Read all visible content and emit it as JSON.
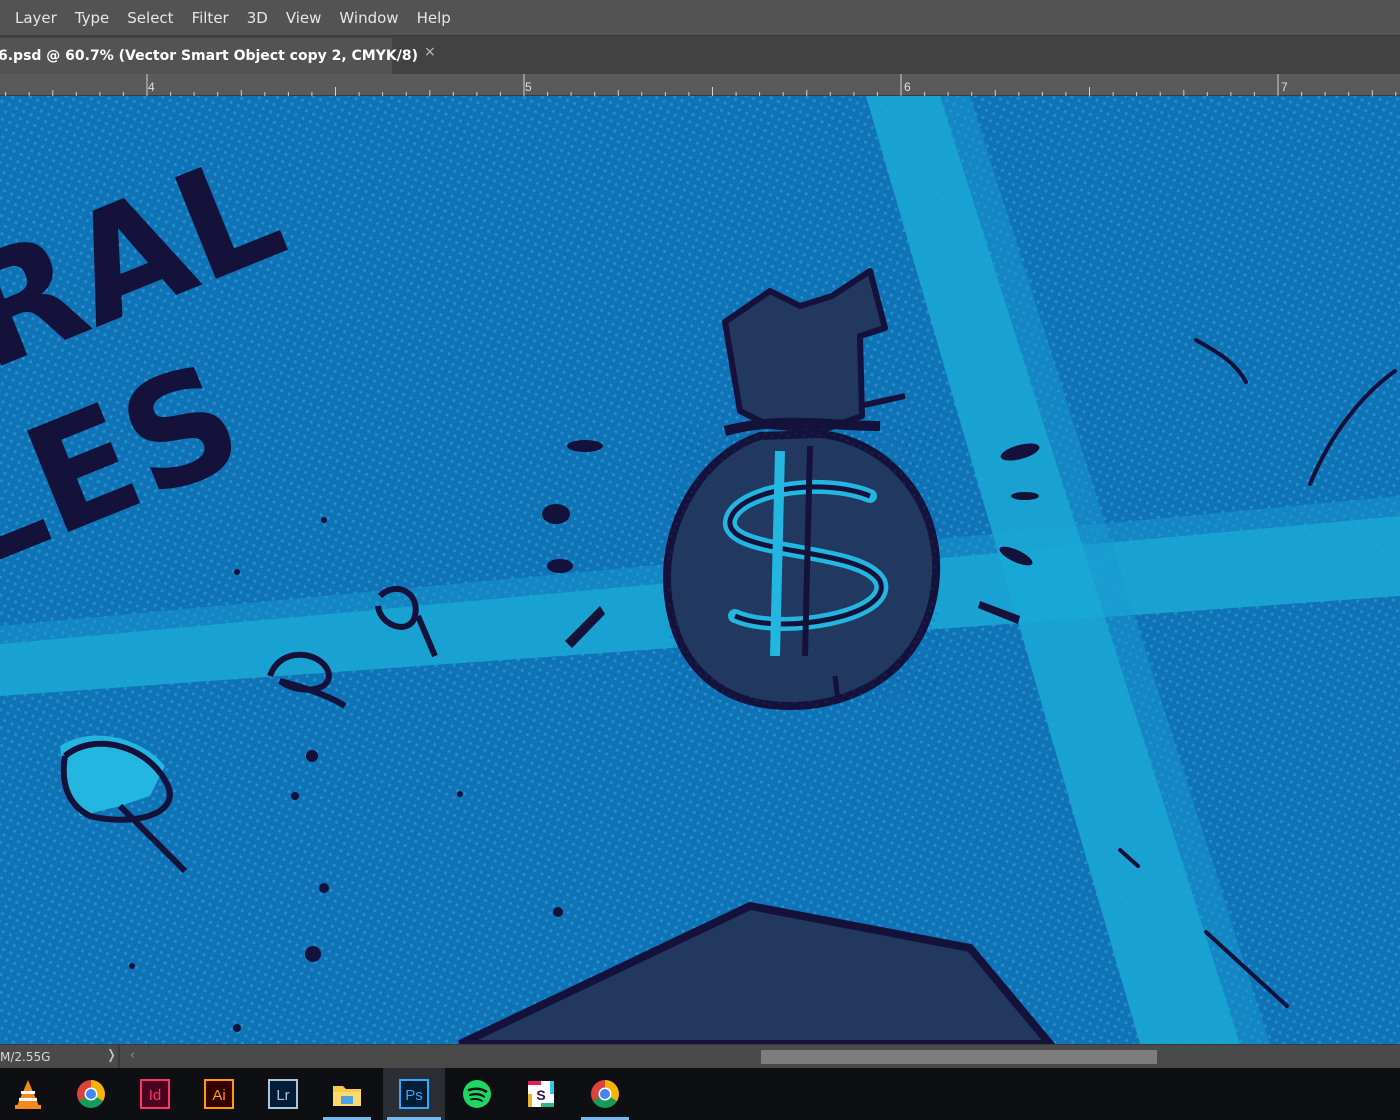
{
  "menubar": {
    "items": [
      "Layer",
      "Type",
      "Select",
      "Filter",
      "3D",
      "View",
      "Window",
      "Help"
    ]
  },
  "document_tab": {
    "title": "6.psd @ 60.7% (Vector Smart Object copy 2, CMYK/8)",
    "close_glyph": "×"
  },
  "ruler": {
    "labels": [
      "4",
      "5",
      "6",
      "7"
    ]
  },
  "canvas": {
    "artwork_text_line1": "RAL",
    "artwork_text_line2": "LES",
    "colors": {
      "background": "#0f73b6",
      "light_beam": "#1aa9d6",
      "ink": "#14123a",
      "bag_fill": "#22385e",
      "accent_cyan": "#22b6e0"
    }
  },
  "statusbar": {
    "doc_size": "M/2.55G",
    "arrow": "❭",
    "scroll_left": "‹"
  },
  "taskbar": {
    "apps": [
      {
        "name": "VLC media player",
        "icon": "vlc-icon",
        "running": false
      },
      {
        "name": "Google Chrome",
        "icon": "chrome-icon",
        "running": false
      },
      {
        "name": "Adobe InDesign",
        "icon": "indesign-icon",
        "label": "Id",
        "running": false
      },
      {
        "name": "Adobe Illustrator",
        "icon": "illustrator-icon",
        "label": "Ai",
        "running": false
      },
      {
        "name": "Adobe Lightroom",
        "icon": "lightroom-icon",
        "label": "Lr",
        "running": false
      },
      {
        "name": "File Explorer",
        "icon": "folder-icon",
        "running": true
      },
      {
        "name": "Adobe Photoshop",
        "icon": "photoshop-icon",
        "label": "Ps",
        "running": true,
        "active": true
      },
      {
        "name": "Spotify",
        "icon": "spotify-icon",
        "running": false
      },
      {
        "name": "Slack",
        "icon": "slack-icon",
        "label": "S",
        "running": false
      },
      {
        "name": "Google Chrome",
        "icon": "chrome-icon",
        "running": true
      }
    ]
  }
}
